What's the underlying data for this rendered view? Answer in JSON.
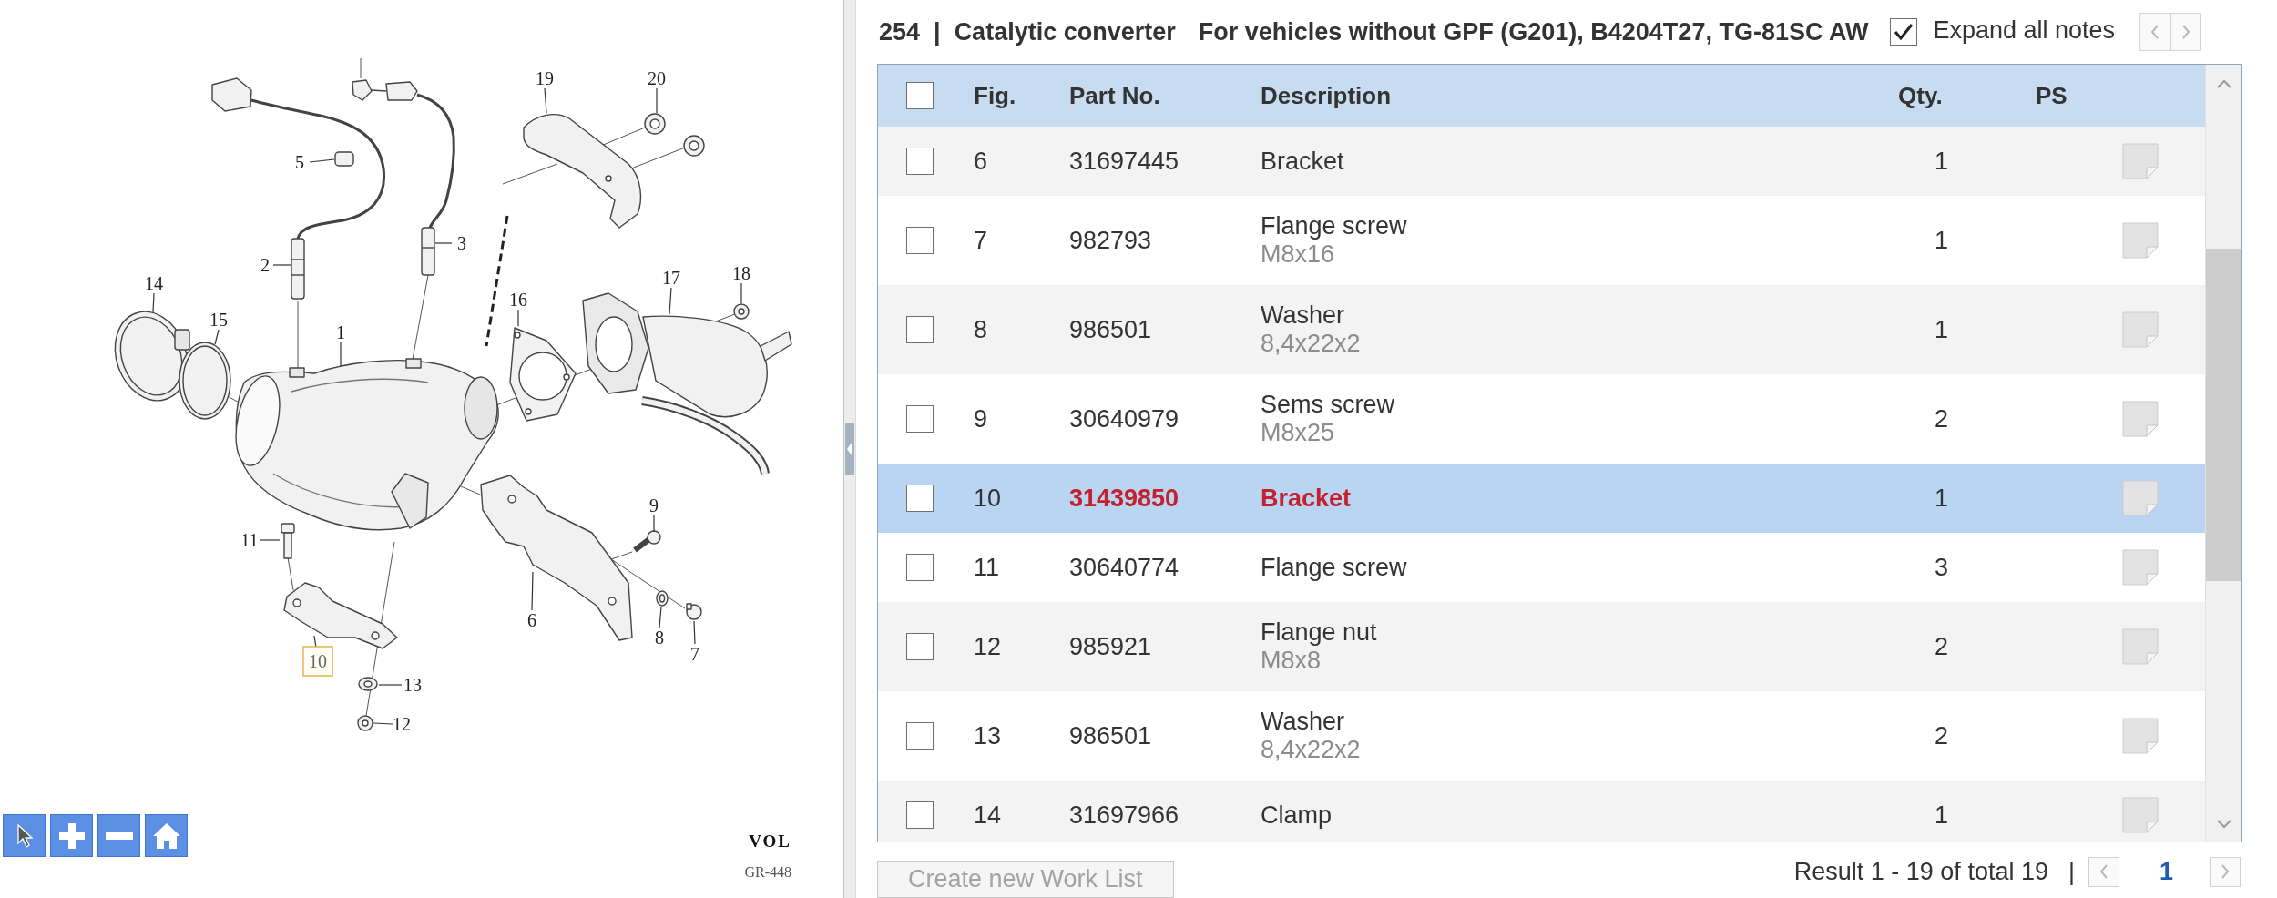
{
  "diagram": {
    "callouts": [
      {
        "number": "19",
        "selected": false
      },
      {
        "number": "20",
        "selected": false
      },
      {
        "number": "5",
        "selected": false
      },
      {
        "number": "3",
        "selected": false
      },
      {
        "number": "2",
        "selected": false
      },
      {
        "number": "14",
        "selected": false
      },
      {
        "number": "17",
        "selected": false
      },
      {
        "number": "18",
        "selected": false
      },
      {
        "number": "16",
        "selected": false
      },
      {
        "number": "15",
        "selected": false
      },
      {
        "number": "1",
        "selected": false
      },
      {
        "number": "9",
        "selected": false
      },
      {
        "number": "11",
        "selected": false
      },
      {
        "number": "6",
        "selected": false
      },
      {
        "number": "8",
        "selected": false
      },
      {
        "number": "10",
        "selected": true
      },
      {
        "number": "7",
        "selected": false
      },
      {
        "number": "13",
        "selected": false
      },
      {
        "number": "12",
        "selected": false
      }
    ],
    "logo": "VOL",
    "drawing_code": "GR-448"
  },
  "header": {
    "group_number": "254",
    "separator": "|",
    "group_name": "Catalytic converter",
    "variant": "For vehicles without GPF (G201), B4204T27, TG-81SC AW",
    "expand_all_notes": {
      "label": "Expand all notes",
      "checked": true
    }
  },
  "table": {
    "select_all": {
      "checked": false
    },
    "columns": [
      "Fig.",
      "Part No.",
      "Description",
      "Qty.",
      "PS"
    ],
    "rows": [
      {
        "fig": "6",
        "part_no": "31697445",
        "description": "Bracket",
        "qty": "1",
        "checked": false,
        "selected": false
      },
      {
        "fig": "7",
        "part_no": "982793",
        "description": "Flange screw",
        "spec": "M8x16",
        "qty": "1",
        "checked": false,
        "selected": false
      },
      {
        "fig": "8",
        "part_no": "986501",
        "description": "Washer",
        "spec": "8,4x22x2",
        "qty": "1",
        "checked": false,
        "selected": false
      },
      {
        "fig": "9",
        "part_no": "30640979",
        "description": "Sems screw",
        "spec": "M8x25",
        "qty": "2",
        "checked": false,
        "selected": false
      },
      {
        "fig": "10",
        "part_no": "31439850",
        "description": "Bracket",
        "qty": "1",
        "checked": false,
        "selected": true
      },
      {
        "fig": "11",
        "part_no": "30640774",
        "description": "Flange screw",
        "qty": "3",
        "checked": false,
        "selected": false
      },
      {
        "fig": "12",
        "part_no": "985921",
        "description": "Flange nut",
        "spec": "M8x8",
        "qty": "2",
        "checked": false,
        "selected": false
      },
      {
        "fig": "13",
        "part_no": "986501",
        "description": "Washer",
        "spec": "8,4x22x2",
        "qty": "2",
        "checked": false,
        "selected": false
      },
      {
        "fig": "14",
        "part_no": "31697966",
        "description": "Clamp",
        "qty": "1",
        "checked": false,
        "selected": false
      }
    ]
  },
  "footer": {
    "create_work_list": {
      "label": "Create new Work List",
      "disabled": true
    },
    "result": "Result 1 - 19 of total 19",
    "separator": "|",
    "current_page": "1"
  }
}
